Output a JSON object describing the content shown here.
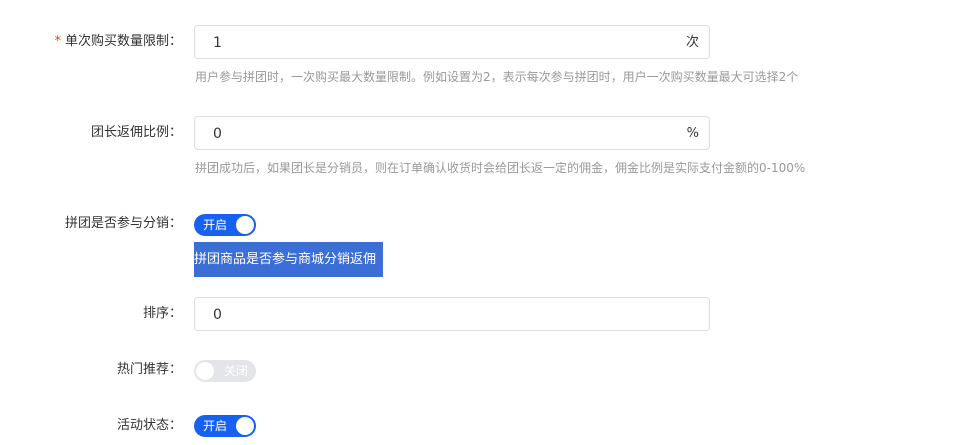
{
  "form": {
    "purchase_limit": {
      "required_mark": "*",
      "label": "单次购买数量限制：",
      "value": "1",
      "suffix": "次",
      "help": "用户参与拼团时，一次购买最大数量限制。例如设置为2，表示每次参与拼团时，用户一次购买数量最大可选择2个"
    },
    "leader_rebate": {
      "label": "团长返佣比例：",
      "value": "0",
      "suffix": "%",
      "help": "拼团成功后，如果团长是分销员，则在订单确认收货时会给团长返一定的佣金，佣金比例是实际支付金额的0-100%"
    },
    "distribution": {
      "label": "拼团是否参与分销：",
      "switch_text": "开启",
      "switch_on": true,
      "note": "拼团商品是否参与商城分销返佣"
    },
    "sort": {
      "label": "排序：",
      "value": "0"
    },
    "hot_recommend": {
      "label": "热门推荐：",
      "switch_text": "关闭",
      "switch_on": false
    },
    "status": {
      "label": "活动状态：",
      "switch_text": "开启",
      "switch_on": true
    }
  },
  "colors": {
    "switch_on": "#1761f0",
    "switch_off": "#e3e5e9",
    "required": "#ed4014",
    "selection": "#3c6fd6"
  }
}
